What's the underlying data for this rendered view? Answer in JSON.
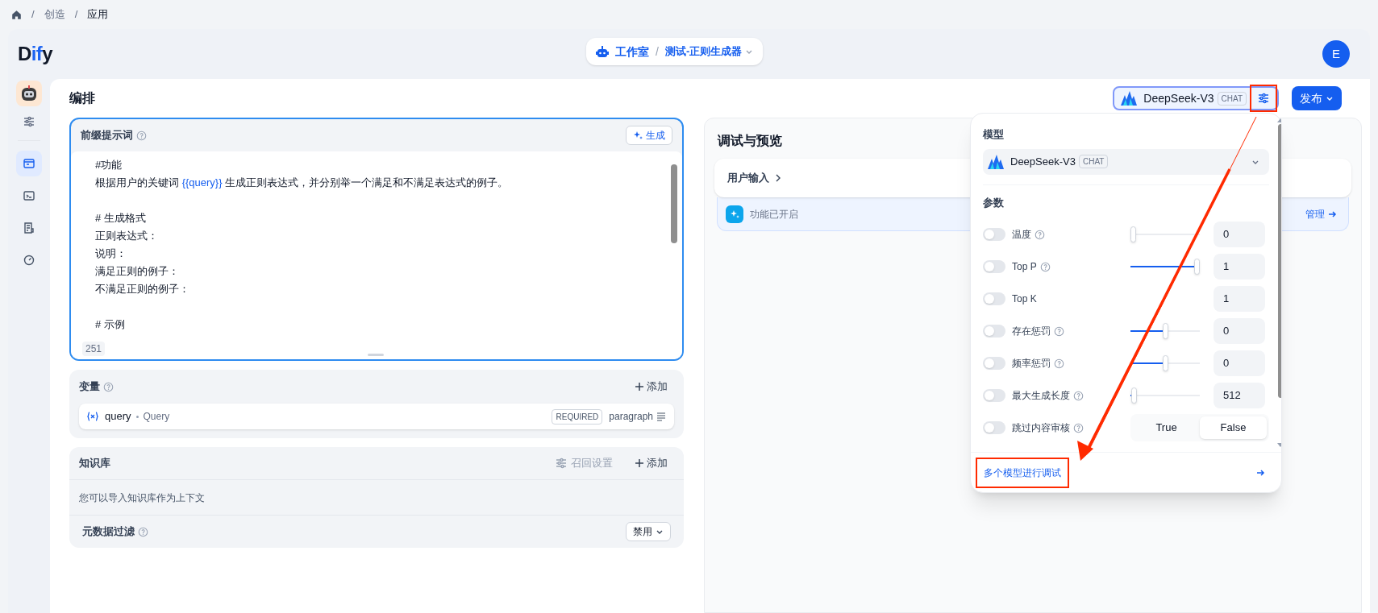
{
  "breadcrumb": [
    {
      "separator": "/",
      "label": "创造"
    },
    {
      "separator": "/",
      "label": "应用"
    }
  ],
  "header": {
    "logo_prefix": "D",
    "logo_mid": "if",
    "logo_suffix": "y",
    "workspace": "工作室",
    "separator": "/",
    "app_name": "测试-正则生成器",
    "avatar": "E"
  },
  "sidebar": {
    "nav": [
      {
        "selected": true
      },
      {
        "selected": false
      },
      {
        "selected": false
      },
      {
        "selected": false
      }
    ]
  },
  "page_title": "编排",
  "prompt": {
    "title": "前缀提示词",
    "generate": "生成",
    "char_count": "251",
    "paragraphs": [
      [
        [
          {
            "kind": "text",
            "text": "#功能"
          }
        ],
        [
          {
            "kind": "text",
            "text": "根据用户的关键词 "
          },
          {
            "kind": "variable",
            "text": "{{query}}"
          },
          {
            "kind": "text",
            "text": " 生成正则表达式，并分别举一个满足和不满足表达式的例子。"
          }
        ]
      ],
      [
        [
          {
            "kind": "text",
            "text": "# 生成格式"
          }
        ],
        [
          {
            "kind": "text",
            "text": "正则表达式："
          }
        ],
        [
          {
            "kind": "text",
            "text": "说明："
          }
        ],
        [
          {
            "kind": "text",
            "text": "满足正则的例子："
          }
        ],
        [
          {
            "kind": "text",
            "text": "不满足正则的例子："
          }
        ]
      ],
      [
        [
          {
            "kind": "text",
            "text": "# 示例"
          }
        ]
      ]
    ]
  },
  "variables": {
    "title": "变量",
    "add": "添加",
    "items": [
      {
        "key": "query",
        "name": "Query",
        "required": "REQUIRED",
        "type": "paragraph"
      }
    ]
  },
  "knowledge": {
    "title": "知识库",
    "recall_settings": "召回设置",
    "add": "添加",
    "empty": "您可以导入知识库作为上下文",
    "metadata_filter": {
      "label": "元数据过滤",
      "value": "禁用"
    }
  },
  "debug": {
    "title": "调试与预览",
    "user_input": "用户输入",
    "feature": "功能已开启",
    "manage": "管理"
  },
  "toolbar": {
    "model": "DeepSeek-V3",
    "mode": "CHAT",
    "settings_highlighted": true,
    "publish": "发布"
  },
  "popover": {
    "model_label": "模型",
    "model": "DeepSeek-V3",
    "mode": "CHAT",
    "params_label": "参数",
    "multi_model_link": "多个模型进行调试",
    "link_highlighted": true,
    "params": [
      {
        "kind": "slider",
        "label": "温度",
        "help": true,
        "enabled": false,
        "level": 0,
        "value": "0"
      },
      {
        "kind": "slider",
        "label": "Top P",
        "help": true,
        "enabled": false,
        "level": 1,
        "value": "1"
      },
      {
        "kind": "number",
        "label": "Top K",
        "help": false,
        "enabled": false,
        "value": "1"
      },
      {
        "kind": "slider",
        "label": "存在惩罚",
        "help": true,
        "enabled": false,
        "level": 0.5,
        "value": "0"
      },
      {
        "kind": "slider",
        "label": "频率惩罚",
        "help": true,
        "enabled": false,
        "level": 0.5,
        "value": "0"
      },
      {
        "kind": "slider",
        "label": "最大生成长度",
        "help": true,
        "enabled": false,
        "level": 0.01,
        "value": "512"
      },
      {
        "kind": "boolean",
        "label": "跳过内容审核",
        "help": true,
        "enabled": false,
        "options": [
          {
            "label": "True",
            "selected": false
          },
          {
            "label": "False",
            "selected": true
          }
        ]
      }
    ]
  },
  "annotation_arrow": true
}
